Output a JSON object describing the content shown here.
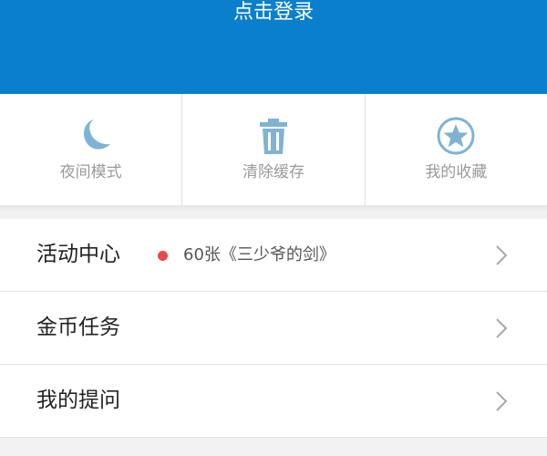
{
  "header": {
    "login_label": "点击登录"
  },
  "quick_actions": [
    {
      "label": "夜间模式",
      "icon": "moon-icon"
    },
    {
      "label": "清除缓存",
      "icon": "trash-icon"
    },
    {
      "label": "我的收藏",
      "icon": "star-circle-icon"
    }
  ],
  "menu": [
    {
      "label": "活动中心",
      "promo_text": "60张《三少爷的剑》",
      "icon": "chevron-right-icon"
    },
    {
      "label": "金币任务",
      "icon": "chevron-right-icon"
    },
    {
      "label": "我的提问",
      "icon": "chevron-right-icon"
    }
  ],
  "colors": {
    "header": "#0a7fcb",
    "icon": "#7fb3d3",
    "promo_dot": "#e64a4a"
  }
}
